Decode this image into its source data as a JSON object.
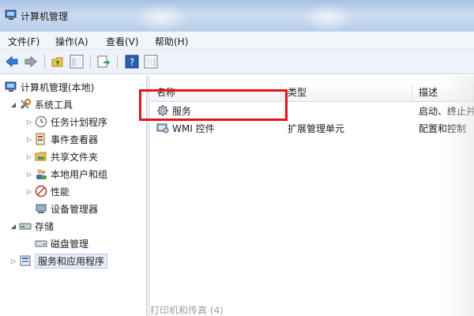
{
  "window": {
    "title": "计算机管理"
  },
  "menu": [
    "文件(F)",
    "操作(A)",
    "查看(V)",
    "帮助(H)"
  ],
  "tree": {
    "root": "计算机管理(本地)",
    "system_tools": "系统工具",
    "items": [
      "任务计划程序",
      "事件查看器",
      "共享文件夹",
      "本地用户和组",
      "性能",
      "设备管理器"
    ],
    "storage": "存储",
    "disk": "磁盘管理",
    "services_apps": "服务和应用程序"
  },
  "list": {
    "headers": [
      "名称",
      "类型",
      "描述"
    ],
    "rows": [
      {
        "name": "服务",
        "type": "",
        "desc": "启动、终止并"
      },
      {
        "name": "WMI 控件",
        "type": "扩展管理单元",
        "desc": "配置和控制"
      }
    ]
  },
  "bottom_text": "打印机和传真 (4)",
  "colors": {
    "highlight": "#e8121a",
    "titlebar": "#b9cfe9"
  }
}
